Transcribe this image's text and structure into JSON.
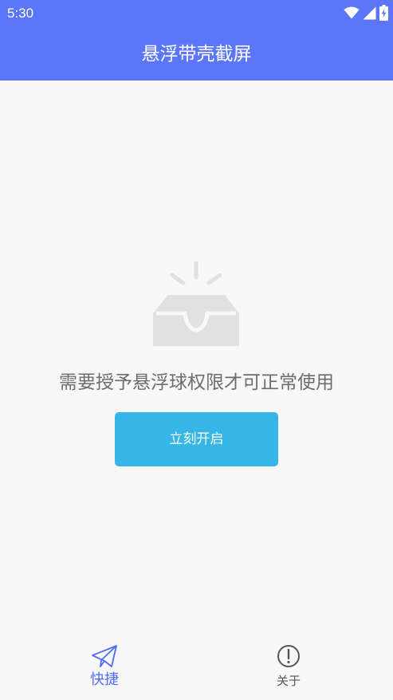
{
  "status_bar": {
    "time": "5:30",
    "icons": [
      "wifi-icon",
      "signal-icon",
      "battery-charging-icon"
    ]
  },
  "app_bar": {
    "title": "悬浮带壳截屏",
    "background_color": "#5c76f9"
  },
  "empty_state": {
    "icon": "empty-inbox-icon",
    "message": "需要授予悬浮球权限才可正常使用",
    "button_label": "立刻开启",
    "button_color": "#35b6e6"
  },
  "bottom_nav": {
    "items": [
      {
        "label": "快捷",
        "icon": "paper-plane-icon",
        "active": true
      },
      {
        "label": "关于",
        "icon": "info-circle-icon",
        "active": false
      }
    ],
    "active_color": "#4f6ef5"
  }
}
